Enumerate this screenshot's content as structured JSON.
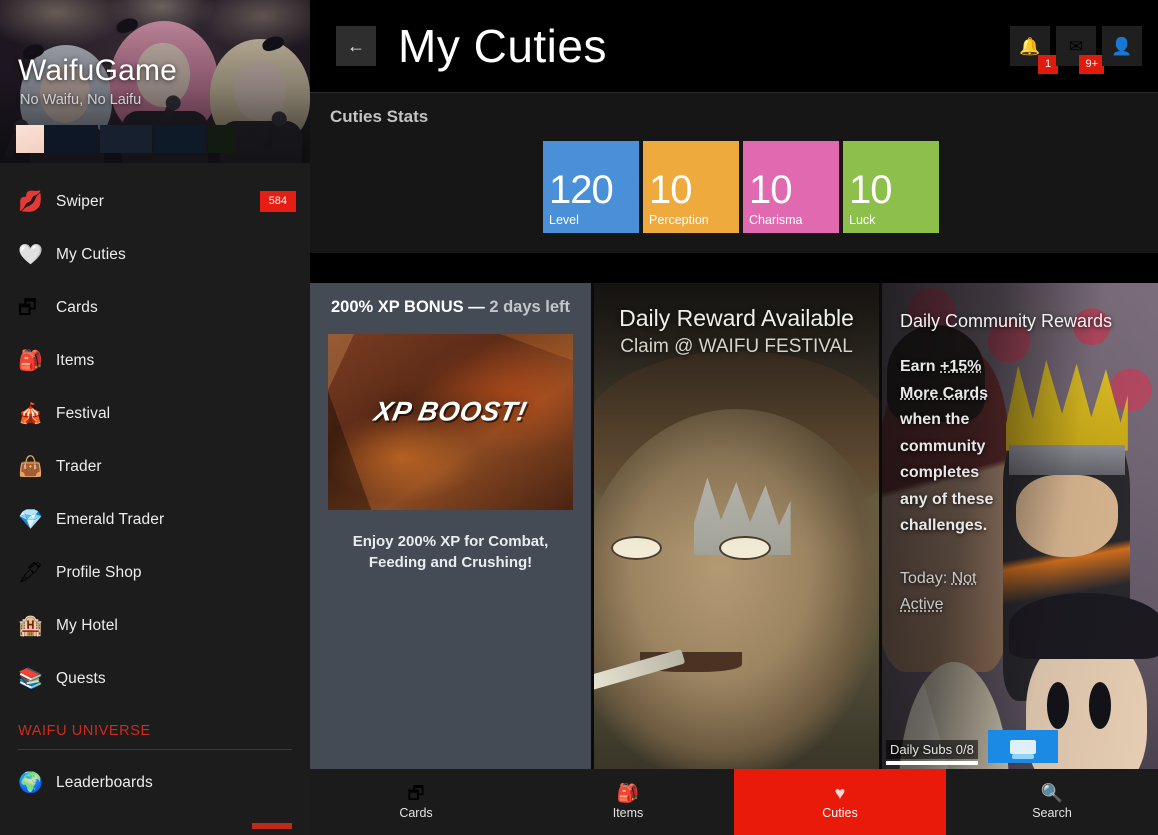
{
  "sidebar": {
    "brand": {
      "title": "WaifuGame",
      "tagline": "No Waifu, No Laifu"
    },
    "items": [
      {
        "label": "Swiper",
        "icon": "lips-icon",
        "glyph": "💋",
        "badge": "584"
      },
      {
        "label": "My Cuties",
        "icon": "heart-icon",
        "glyph": "🤍",
        "badge": ""
      },
      {
        "label": "Cards",
        "icon": "cards-icon",
        "glyph": "🗗",
        "badge": ""
      },
      {
        "label": "Items",
        "icon": "backpack-icon",
        "glyph": "🎒",
        "badge": ""
      },
      {
        "label": "Festival",
        "icon": "circus-tent-icon",
        "glyph": "🎪",
        "badge": ""
      },
      {
        "label": "Trader",
        "icon": "handbag-icon",
        "glyph": "👜",
        "badge": ""
      },
      {
        "label": "Emerald Trader",
        "icon": "gem-icon",
        "glyph": "💎",
        "badge": ""
      },
      {
        "label": "Profile Shop",
        "icon": "pen-icon",
        "glyph": "🖋",
        "badge": ""
      },
      {
        "label": "My Hotel",
        "icon": "hotel-icon",
        "glyph": "🏨",
        "badge": ""
      },
      {
        "label": "Quests",
        "icon": "books-icon",
        "glyph": "📚",
        "badge": ""
      }
    ],
    "section_label": "WAIFU UNIVERSE",
    "universe_items": [
      {
        "label": "Leaderboards",
        "icon": "globe-icon",
        "glyph": "🌍"
      }
    ]
  },
  "header": {
    "back_label": "←",
    "title": "My Cuties",
    "actions": [
      {
        "name": "notifications",
        "glyph": "🔔",
        "badge": "1"
      },
      {
        "name": "messages",
        "glyph": "✉",
        "badge": "9+"
      },
      {
        "name": "add-friend",
        "glyph": "👤",
        "badge": ""
      }
    ]
  },
  "stats": {
    "title": "Cuties Stats",
    "cards": [
      {
        "value": "120",
        "label": "Level",
        "color": "#4a90d9"
      },
      {
        "value": "10",
        "label": "Perception",
        "color": "#eeaa3c"
      },
      {
        "value": "10",
        "label": "Charisma",
        "color": "#e069b0"
      },
      {
        "value": "10",
        "label": "Luck",
        "color": "#8dc04a"
      }
    ]
  },
  "promos": {
    "xp": {
      "title_main": "200% XP BONUS — ",
      "title_dim": "2 days left",
      "banner_text": "XP BOOST!",
      "description": "Enjoy 200% XP for Combat, Feeding and Crushing!"
    },
    "daily": {
      "title": "Daily Reward Available",
      "subtitle": "Claim @ WAIFU FESTIVAL"
    },
    "community": {
      "title": "Daily Community Rewards",
      "body_pre": "Earn ",
      "body_link": "+15% More Cards",
      "body_post": " when the community completes any of these challenges.",
      "today_pre": "Today: ",
      "today_link": "Not Active",
      "subs_label": "Daily Subs 0/8",
      "claim_icon": "card-icon"
    }
  },
  "bottomnav": {
    "items": [
      {
        "label": "Cards",
        "icon": "cards-icon",
        "glyph": "🗗",
        "active": false
      },
      {
        "label": "Items",
        "icon": "backpack-icon",
        "glyph": "🎒",
        "active": false
      },
      {
        "label": "Cuties",
        "icon": "heart-icon",
        "glyph": "♥",
        "active": true
      },
      {
        "label": "Search",
        "icon": "search-icon",
        "glyph": "🔍",
        "active": false
      }
    ]
  }
}
